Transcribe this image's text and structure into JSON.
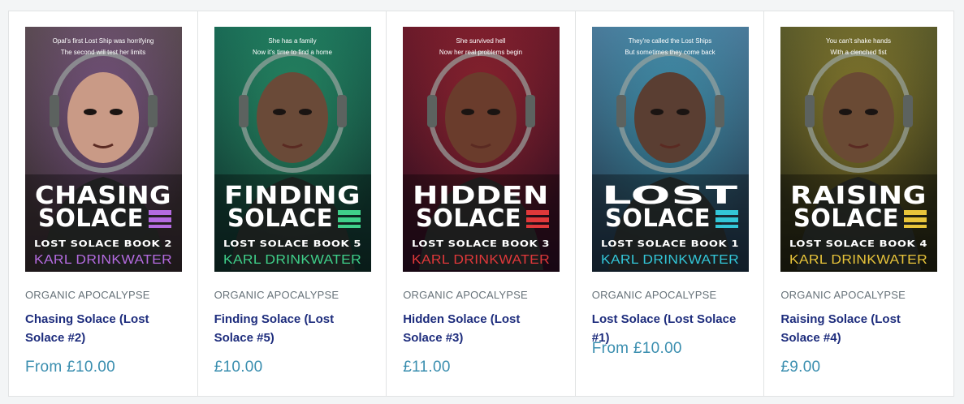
{
  "products": [
    {
      "vendor": "ORGANIC APOCALYPSE",
      "title": "Chasing Solace (Lost Solace #2)",
      "price": "From £10.00",
      "cover": {
        "tagline1": "Opal's first Lost Ship was horrifying",
        "tagline2": "The second will test her limits",
        "word1": "CHASING",
        "word2": "SOLACE",
        "book": "LOST SOLACE BOOK 2",
        "author": "KARL DRINKWATER",
        "accent": "#b46be0",
        "bg_top": "#5a4a52",
        "bg_bottom": "#2e2428",
        "skin": "#c99a86"
      }
    },
    {
      "vendor": "ORGANIC APOCALYPSE",
      "title": "Finding Solace (Lost Solace #5)",
      "price": "£10.00",
      "cover": {
        "tagline1": "She has a family",
        "tagline2": "Now it's time to find a home",
        "word1": "FINDING",
        "word2": "SOLACE",
        "book": "LOST SOLACE BOOK 5",
        "author": "KARL DRINKWATER",
        "accent": "#3fd08a",
        "bg_top": "#1a6a55",
        "bg_bottom": "#0f2a26",
        "skin": "#6a4a38"
      }
    },
    {
      "vendor": "ORGANIC APOCALYPSE",
      "title": "Hidden Solace (Lost Solace #3)",
      "price": "£11.00",
      "cover": {
        "tagline1": "She survived hell",
        "tagline2": "Now her real problems begin",
        "word1": "HIDDEN",
        "word2": "SOLACE",
        "book": "LOST SOLACE BOOK 3",
        "author": "KARL DRINKWATER",
        "accent": "#e0383a",
        "bg_top": "#6a1a2a",
        "bg_bottom": "#240c1e",
        "skin": "#6a3c2c"
      }
    },
    {
      "vendor": "ORGANIC APOCALYPSE",
      "title": "Lost Solace (Lost Solace #1)",
      "price": "From £10.00",
      "cover": {
        "tagline1": "They're called the Lost Ships",
        "tagline2": "But sometimes they come back",
        "word1": "LOST",
        "word2": "SOLACE",
        "book": "LOST SOLACE BOOK 1",
        "author": "KARL DRINKWATER",
        "accent": "#33c6d8",
        "bg_top": "#4a7a9a",
        "bg_bottom": "#1a2c3c",
        "skin": "#5a3e32"
      }
    },
    {
      "vendor": "ORGANIC APOCALYPSE",
      "title": "Raising Solace (Lost Solace #4)",
      "price": "£9.00",
      "cover": {
        "tagline1": "You can't shake hands",
        "tagline2": "With a clenched fist",
        "word1": "RAISING",
        "word2": "SOLACE",
        "book": "LOST SOLACE BOOK 4",
        "author": "KARL DRINKWATER",
        "accent": "#e8c43a",
        "bg_top": "#5a5a2a",
        "bg_bottom": "#1e1e10",
        "skin": "#6a4a34"
      }
    }
  ]
}
